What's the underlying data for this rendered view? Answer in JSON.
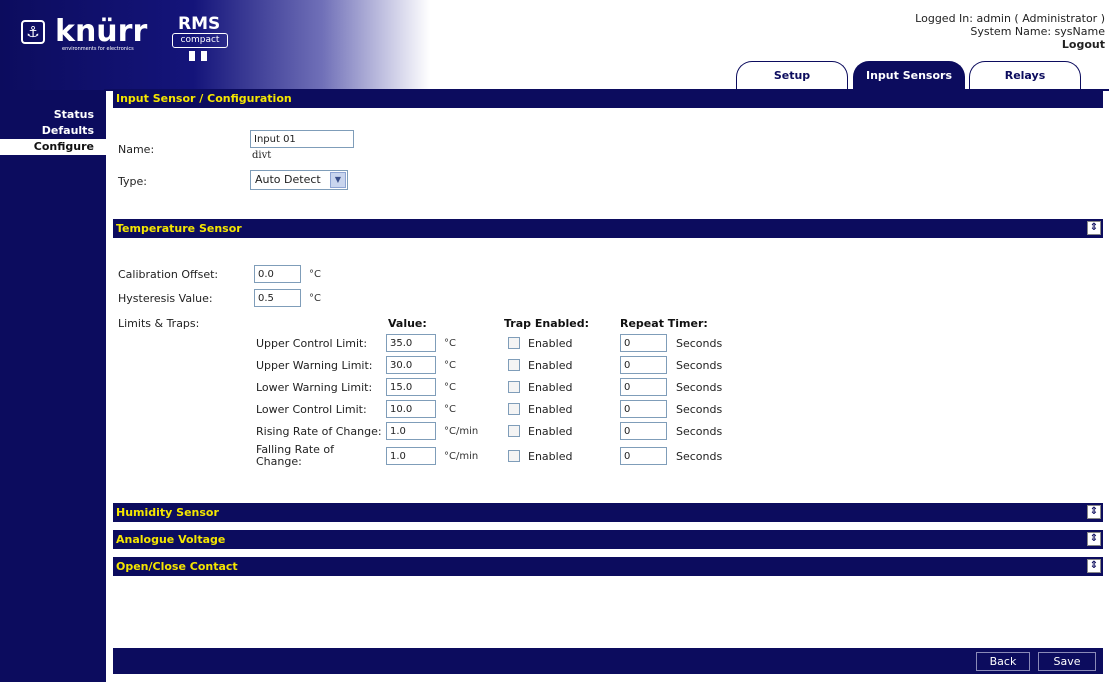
{
  "header": {
    "logo_text": "knürr",
    "logo_tagline": "environments for electronics",
    "product_name": "RMS",
    "product_variant": "compact",
    "logged_in": "Logged In: admin ( Administrator )",
    "system_name": "System Name: sysName",
    "logout": "Logout"
  },
  "tabs": [
    {
      "label": "Setup"
    },
    {
      "label": "Input Sensors",
      "active": true
    },
    {
      "label": "Relays"
    }
  ],
  "sidebar": {
    "items": [
      {
        "label": "Status"
      },
      {
        "label": "Defaults"
      },
      {
        "label": "Configure",
        "active": true
      }
    ]
  },
  "config": {
    "title": "Input Sensor / Configuration",
    "name_label": "Name:",
    "name_value": "Input 01",
    "name_sub": "divt",
    "type_label": "Type:",
    "type_value": "Auto Detect"
  },
  "temperature": {
    "title": "Temperature Sensor",
    "calibration_label": "Calibration Offset:",
    "calibration_value": "0.0",
    "calibration_unit": "°C",
    "hysteresis_label": "Hysteresis Value:",
    "hysteresis_value": "0.5",
    "hysteresis_unit": "°C",
    "limits_label": "Limits & Traps:",
    "col_value": "Value:",
    "col_trap": "Trap Enabled:",
    "col_repeat": "Repeat Timer:",
    "rows": [
      {
        "label": "Upper Control Limit:",
        "value": "35.0",
        "unit": "°C",
        "trap": "Enabled",
        "timer": "0",
        "timer_unit": "Seconds"
      },
      {
        "label": "Upper Warning Limit:",
        "value": "30.0",
        "unit": "°C",
        "trap": "Enabled",
        "timer": "0",
        "timer_unit": "Seconds"
      },
      {
        "label": "Lower Warning Limit:",
        "value": "15.0",
        "unit": "°C",
        "trap": "Enabled",
        "timer": "0",
        "timer_unit": "Seconds"
      },
      {
        "label": "Lower Control Limit:",
        "value": "10.0",
        "unit": "°C",
        "trap": "Enabled",
        "timer": "0",
        "timer_unit": "Seconds"
      },
      {
        "label": "Rising Rate of Change:",
        "value": "1.0",
        "unit": "°C/min",
        "trap": "Enabled",
        "timer": "0",
        "timer_unit": "Seconds"
      },
      {
        "label": "Falling Rate of Change:",
        "value": "1.0",
        "unit": "°C/min",
        "trap": "Enabled",
        "timer": "0",
        "timer_unit": "Seconds"
      }
    ]
  },
  "sections": {
    "humidity": "Humidity Sensor",
    "analogue": "Analogue Voltage",
    "contact": "Open/Close Contact"
  },
  "footer": {
    "back": "Back",
    "save": "Save"
  },
  "colors": {
    "navy": "#0c0c5e",
    "heading_yellow": "#f5e600"
  }
}
